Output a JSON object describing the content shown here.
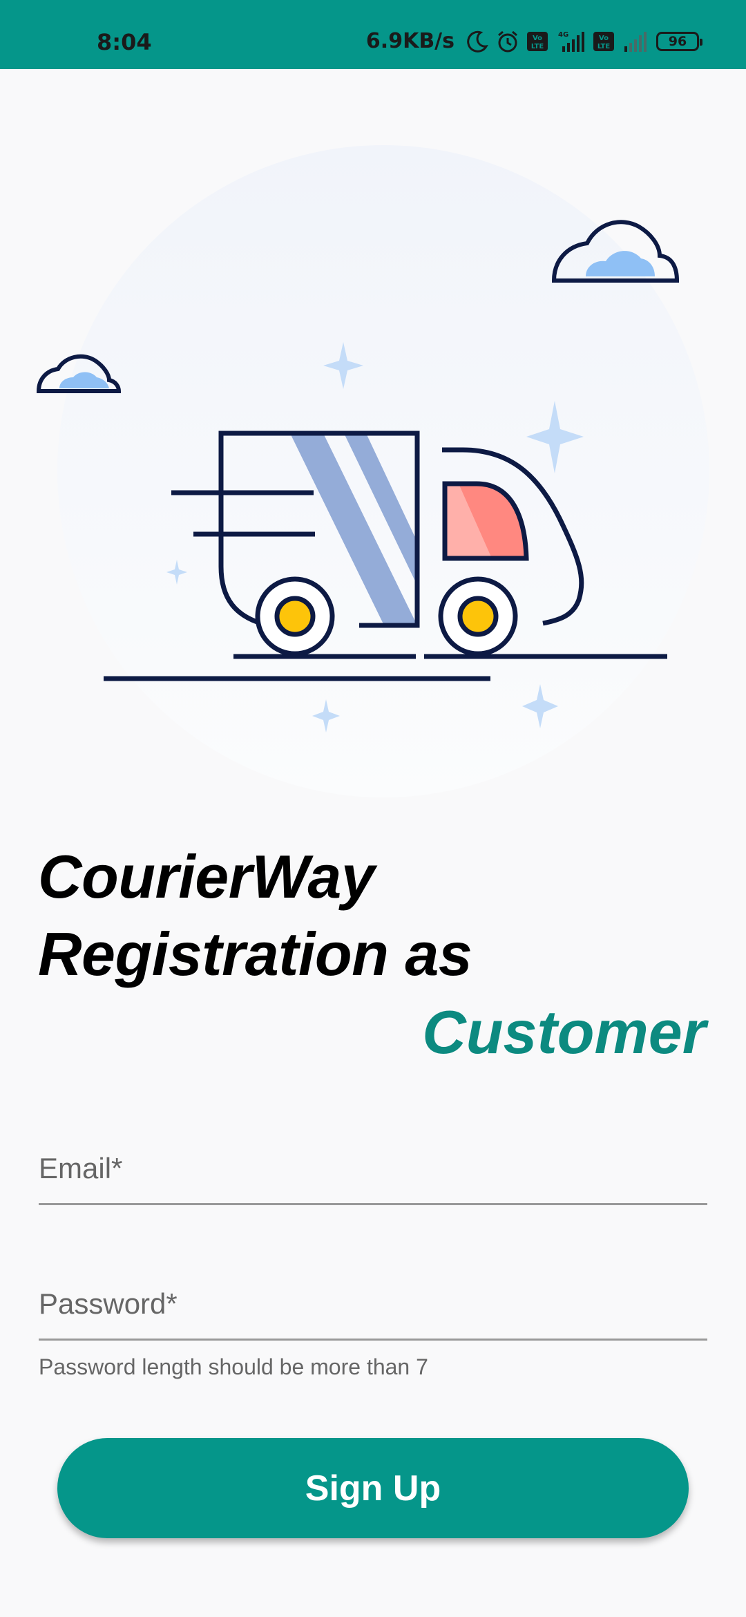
{
  "status_bar": {
    "time": "8:04",
    "net_speed": "6.9KB/s",
    "battery": "96",
    "icons": [
      "moon-icon",
      "alarm-icon",
      "volte-icon",
      "signal-4g-icon",
      "volte-icon",
      "signal-icon",
      "battery-icon"
    ]
  },
  "title": {
    "line1": "CourierWay",
    "line2": "Registration as",
    "accent": "Customer"
  },
  "form": {
    "email_placeholder": "Email*",
    "password_placeholder": "Password*",
    "password_helper": "Password length should be more than 7",
    "signup_label": "Sign Up"
  },
  "colors": {
    "primary": "#05968a",
    "accent_text": "#0c8a80",
    "truck_outline": "#0d1a44",
    "truck_cargo_stripes": "#94acd8",
    "truck_window": "#ff8880",
    "wheel_hub": "#fdc40a",
    "cloud": "#8fc0f5",
    "sparkle": "#c4dcf8"
  }
}
